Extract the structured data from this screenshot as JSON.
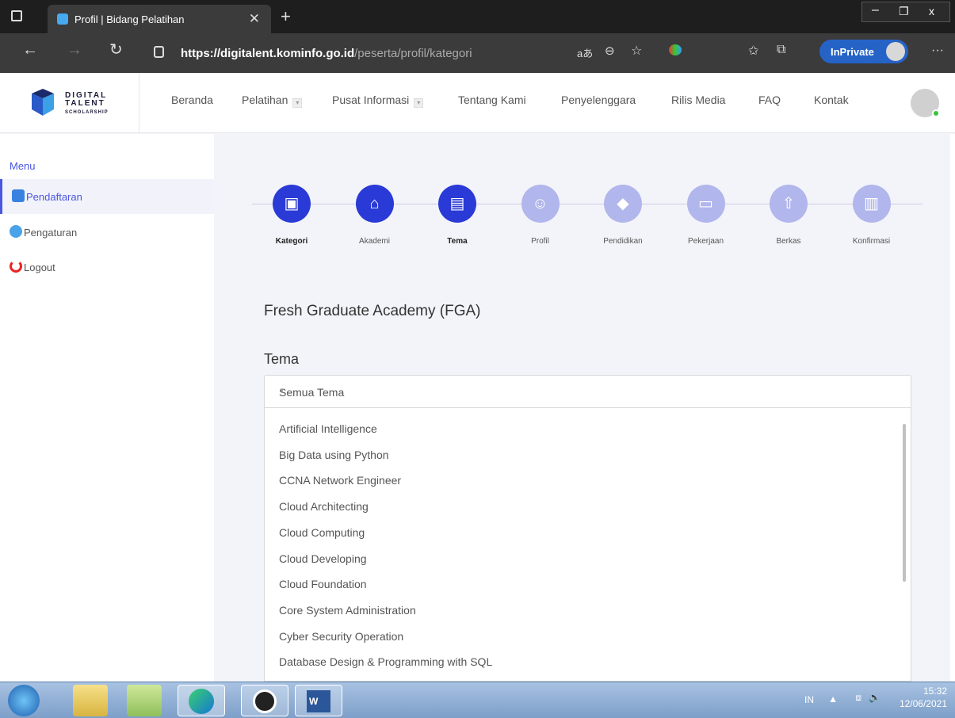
{
  "browser": {
    "tab_title": "Profil | Bidang Pelatihan",
    "url_host": "https://digitalent.kominfo.go.id",
    "url_path": "/peserta/profil/kategori",
    "inprivate": "InPrivate"
  },
  "site": {
    "logo_line1": "DIGITAL",
    "logo_line2": "TALENT",
    "logo_line3": "SCHOLARSHIP",
    "nav": [
      "Beranda",
      "Pelatihan",
      "Pusat Informasi",
      "Tentang Kami",
      "Penyelenggara",
      "Rilis Media",
      "FAQ",
      "Kontak"
    ]
  },
  "sidebar": {
    "heading": "Menu",
    "items": [
      {
        "label": "Pendaftaran",
        "icon": "user-register-icon",
        "active": true
      },
      {
        "label": "Pengaturan",
        "icon": "gears-icon",
        "active": false
      },
      {
        "label": "Logout",
        "icon": "power-icon",
        "active": false
      }
    ]
  },
  "steps": [
    {
      "label": "Kategori",
      "icon": "id-badge-icon",
      "done": true
    },
    {
      "label": "Akademi",
      "icon": "institution-icon",
      "done": true
    },
    {
      "label": "Tema",
      "icon": "book-icon",
      "done": true
    },
    {
      "label": "Profil",
      "icon": "person-icon",
      "done": false
    },
    {
      "label": "Pendidikan",
      "icon": "graduation-cap-icon",
      "done": false
    },
    {
      "label": "Pekerjaan",
      "icon": "briefcase-icon",
      "done": false
    },
    {
      "label": "Berkas",
      "icon": "cloud-upload-icon",
      "done": false
    },
    {
      "label": "Konfirmasi",
      "icon": "clipboard-icon",
      "done": false
    }
  ],
  "form": {
    "academy": "Fresh Graduate Academy (FGA)",
    "tema_label": "Tema",
    "selected": "Semua Tema",
    "options": [
      "Artificial Intelligence",
      "Big Data using Python",
      "CCNA Network Engineer",
      "Cloud Architecting",
      "Cloud Computing",
      "Cloud Developing",
      "Cloud Foundation",
      "Core System Administration",
      "Cyber Security Operation",
      "Database Design & Programming with SQL"
    ]
  },
  "taskbar": {
    "lang": "IN",
    "time": "15:32",
    "date": "12/06/2021"
  },
  "colors": {
    "primary": "#2a3ad6",
    "step_pending": "#b1b6ec",
    "accent": "#4a56e2"
  }
}
